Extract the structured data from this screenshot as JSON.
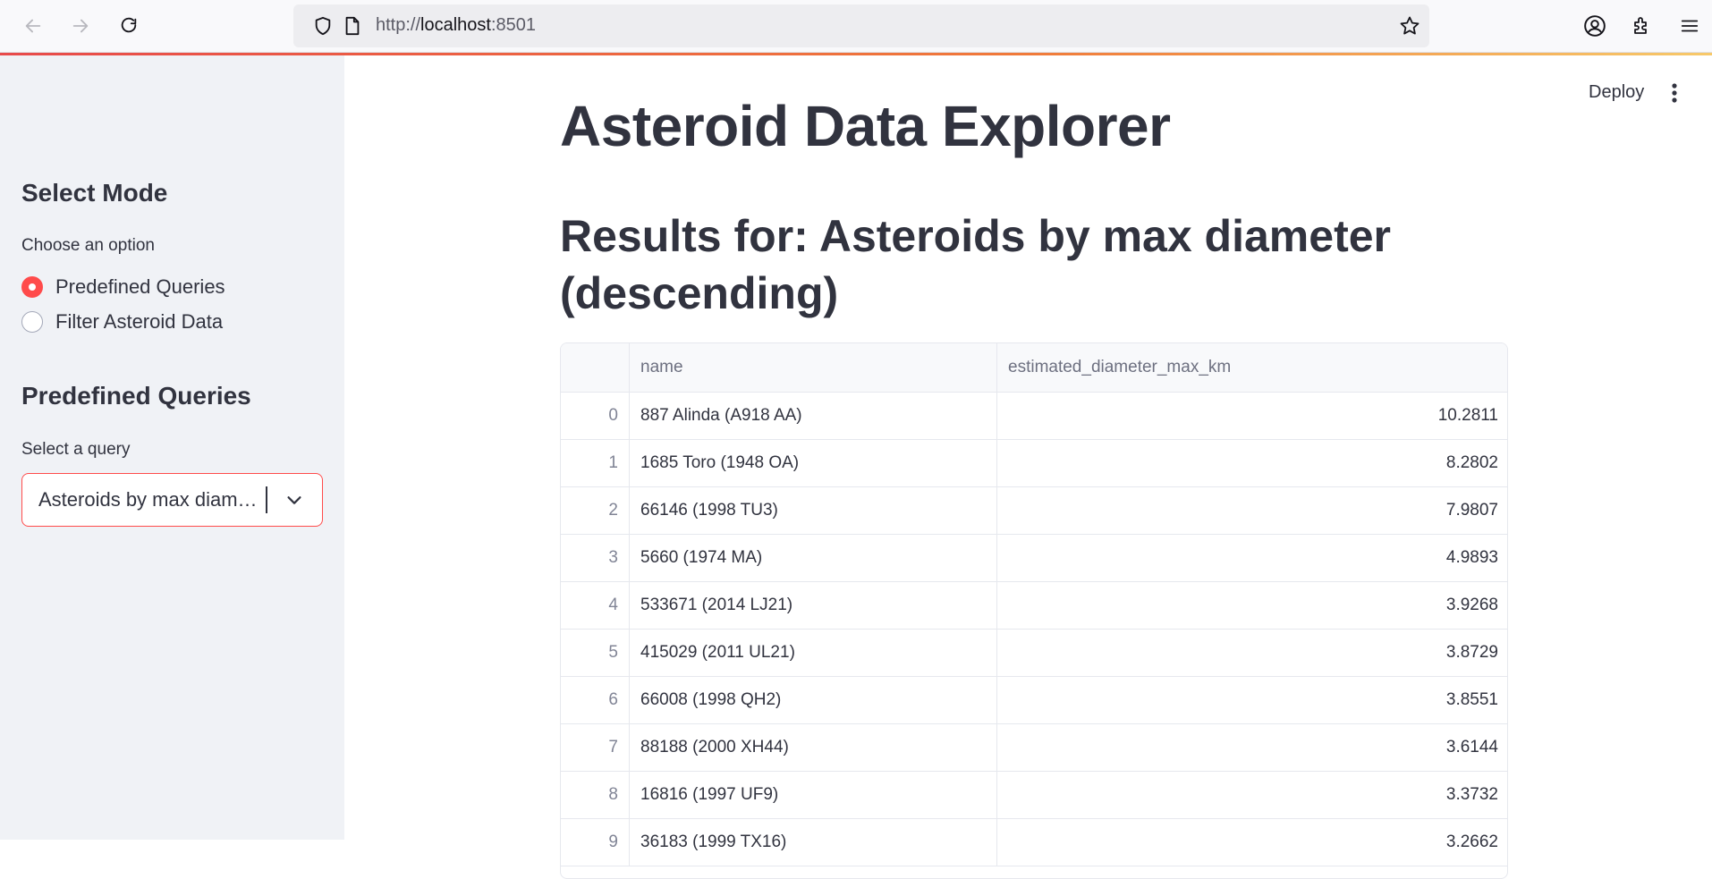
{
  "browser": {
    "url_prefix": "http://",
    "url_host": "localhost",
    "url_suffix": ":8501"
  },
  "header": {
    "deploy_label": "Deploy"
  },
  "sidebar": {
    "mode_heading": "Select Mode",
    "mode_label": "Choose an option",
    "mode_options": [
      "Predefined Queries",
      "Filter Asteroid Data"
    ],
    "mode_selected": "Predefined Queries",
    "queries_heading": "Predefined Queries",
    "query_label": "Select a query",
    "query_value": "Asteroids by max diam…"
  },
  "main": {
    "title": "Asteroid Data Explorer",
    "subtitle": "Results for: Asteroids by max diameter (descending)"
  },
  "table": {
    "columns": [
      "",
      "name",
      "estimated_diameter_max_km"
    ],
    "rows": [
      {
        "index": "0",
        "name": "887 Alinda (A918 AA)",
        "diameter": "10.2811"
      },
      {
        "index": "1",
        "name": "1685 Toro (1948 OA)",
        "diameter": "8.2802"
      },
      {
        "index": "2",
        "name": "66146 (1998 TU3)",
        "diameter": "7.9807"
      },
      {
        "index": "3",
        "name": "5660 (1974 MA)",
        "diameter": "4.9893"
      },
      {
        "index": "4",
        "name": "533671 (2014 LJ21)",
        "diameter": "3.9268"
      },
      {
        "index": "5",
        "name": "415029 (2011 UL21)",
        "diameter": "3.8729"
      },
      {
        "index": "6",
        "name": "66008 (1998 QH2)",
        "diameter": "3.8551"
      },
      {
        "index": "7",
        "name": "88188 (2000 XH44)",
        "diameter": "3.6144"
      },
      {
        "index": "8",
        "name": "16816 (1997 UF9)",
        "diameter": "3.3732"
      },
      {
        "index": "9",
        "name": "36183 (1999 TX16)",
        "diameter": "3.2662"
      }
    ]
  },
  "colors": {
    "accent": "#ff4b4b",
    "sidebar_bg": "#f0f2f6",
    "text": "#31333f"
  }
}
